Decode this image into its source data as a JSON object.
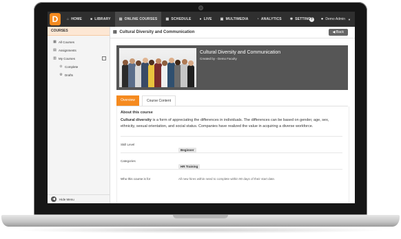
{
  "header": {
    "logo_letter": "D",
    "nav": [
      {
        "label": "HOME",
        "icon": "home-icon",
        "glyph": "⌂"
      },
      {
        "label": "LIBRARY",
        "icon": "video-icon",
        "glyph": "■"
      },
      {
        "label": "ONLINE COURSES",
        "icon": "book-icon",
        "glyph": "▤"
      },
      {
        "label": "SCHEDULE",
        "icon": "calendar-icon",
        "glyph": "▦"
      },
      {
        "label": "LIVE",
        "icon": "live-icon",
        "glyph": "●"
      },
      {
        "label": "MULTIMEDIA",
        "icon": "multimedia-icon",
        "glyph": "▣"
      },
      {
        "label": "ANALYTICS",
        "icon": "chart-icon",
        "glyph": "◔"
      },
      {
        "label": "SETTINGS",
        "icon": "gear-icon",
        "glyph": "✱"
      }
    ],
    "help": "?",
    "user_name": "Demo Admin"
  },
  "sidebar": {
    "title": "COURSES",
    "items": [
      {
        "label": "All Courses",
        "icon": "grid-icon",
        "glyph": "▦"
      },
      {
        "label": "Assignments",
        "icon": "assignment-icon",
        "glyph": "▤"
      },
      {
        "label": "My Courses",
        "icon": "folder-icon",
        "glyph": "▥",
        "collapse": "−"
      },
      {
        "label": "Complete",
        "icon": "check-circle-icon",
        "glyph": "⊙"
      },
      {
        "label": "Drafts",
        "icon": "drafts-icon",
        "glyph": "⚙"
      }
    ],
    "hide_menu": "Hide Menu"
  },
  "page": {
    "title": "Cultural Diversity and Communication",
    "back": "Back"
  },
  "course": {
    "title": "Cultural Diversity and Communication",
    "created_by": "Created by - Demo Faculty"
  },
  "tabs": [
    "Overview",
    "Course Content"
  ],
  "about": {
    "heading": "About this course",
    "lead": "Cultural diversity",
    "text": " is a form of appreciating the differences in individuals. The differences can be based on gender, age, sex, ethnicity, sexual orientation, and social status. Companies have realized the value in acquiring a diverse workforce."
  },
  "details": [
    {
      "label": "Skill Level",
      "value": "Beginner",
      "type": "badge"
    },
    {
      "label": "Categories",
      "value": "HR Training",
      "type": "badge"
    },
    {
      "label": "Who this course is for",
      "value": "All new hires within need to complete within 90 days of their start date.",
      "type": "text"
    }
  ]
}
